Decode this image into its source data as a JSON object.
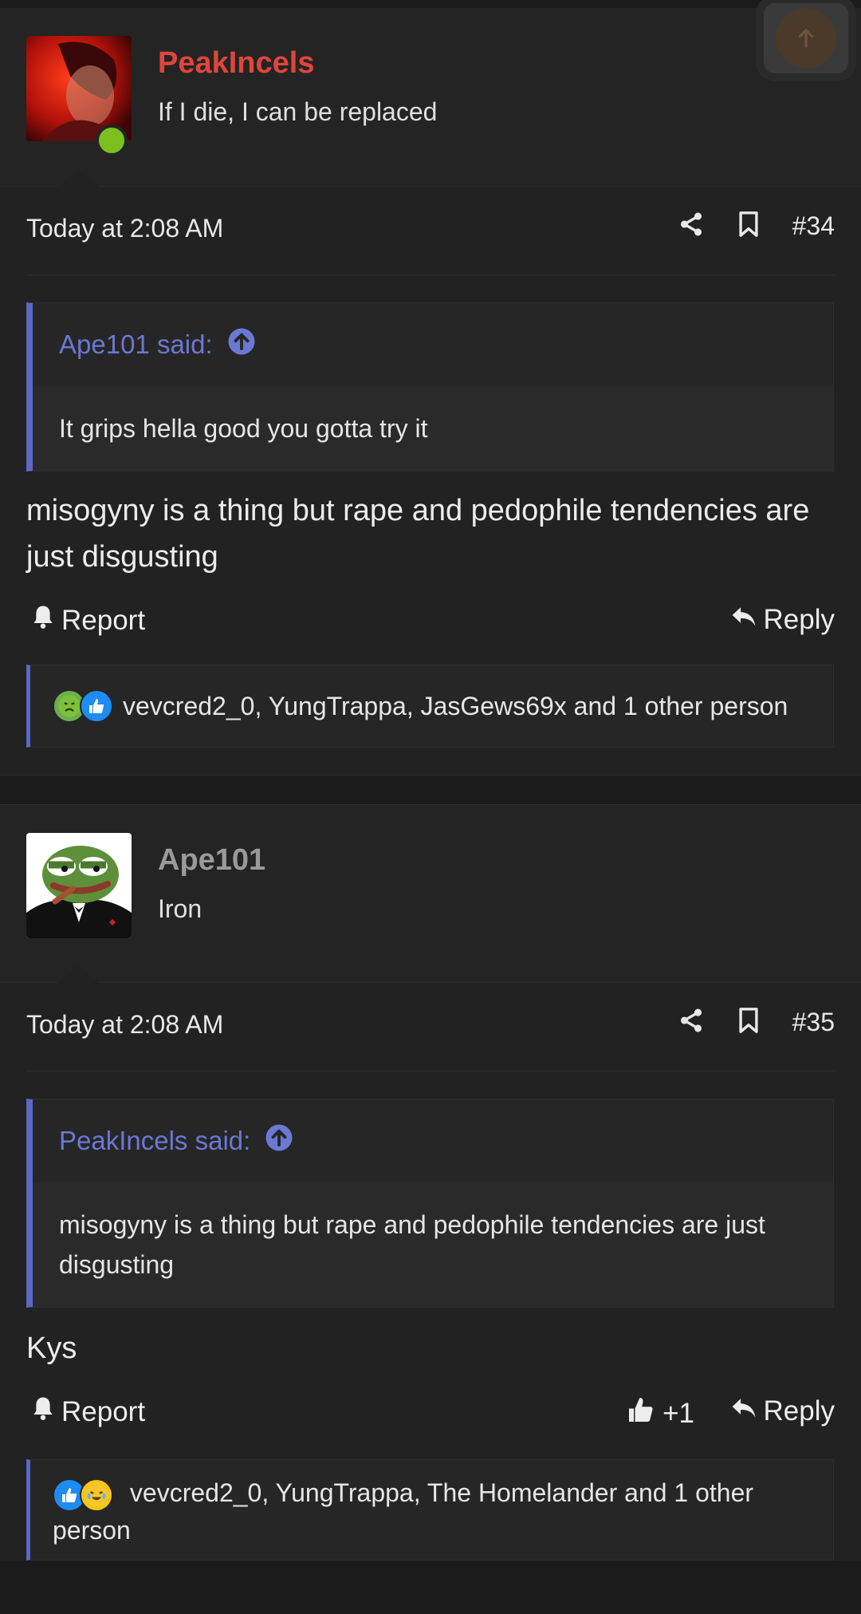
{
  "posts": [
    {
      "username": "PeakIncels",
      "user_title": "If I die, I can be replaced",
      "date": "Today at 2:08 AM",
      "post_number": "#34",
      "quote": {
        "author_line": "Ape101 said:",
        "text": "It grips hella good you gotta try it"
      },
      "body": "misogyny is a thing but rape and pedophile tendencies are just disgusting",
      "actions": {
        "report": "Report",
        "reply": "Reply"
      },
      "reactions": "vevcred2_0, YungTrappa, JasGews69x and 1 other person"
    },
    {
      "username": "Ape101",
      "user_title": "Iron",
      "date": "Today at 2:08 AM",
      "post_number": "#35",
      "quote": {
        "author_line": "PeakIncels said:",
        "text": "misogyny is a thing but rape and pedophile tendencies are just disgusting"
      },
      "body": "Kys",
      "actions": {
        "report": "Report",
        "like_count": "+1",
        "reply": "Reply"
      },
      "reactions": "vevcred2_0, YungTrappa, The Homelander and 1 other person"
    }
  ],
  "colors": {
    "accent": "#5c67c8",
    "username_red": "#e0453a",
    "username_gray": "#9a9a9a",
    "online": "#7cbf1f"
  }
}
